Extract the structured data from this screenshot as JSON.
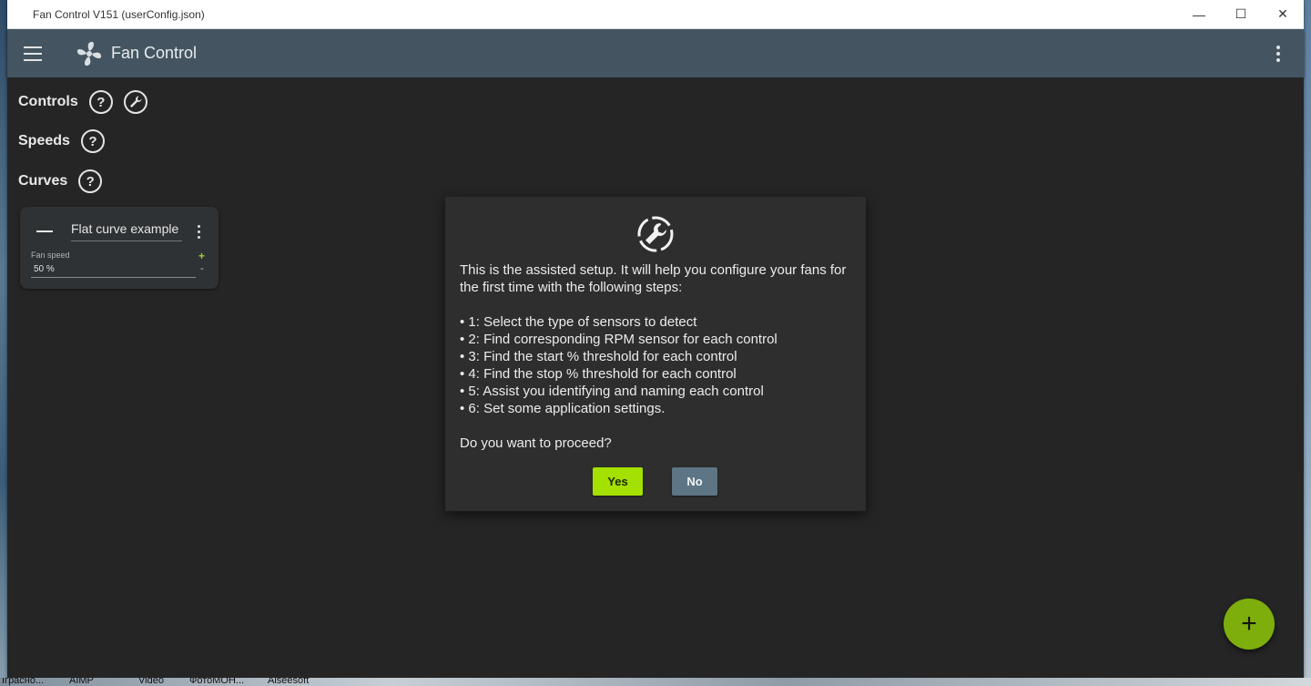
{
  "window": {
    "title": "Fan Control V151 (userConfig.json)",
    "minimize": "—",
    "maximize": "☐",
    "close": "✕"
  },
  "appbar": {
    "title": "Fan Control",
    "menu_icon": "hamburger-icon",
    "logo_icon": "fan-icon",
    "more_icon": "more-vert-icon"
  },
  "sections": {
    "controls": "Controls",
    "speeds": "Speeds",
    "curves": "Curves",
    "help_glyph": "?"
  },
  "curve_card": {
    "name": "Flat curve example",
    "fan_speed_label": "Fan speed",
    "value": "50 %",
    "plus": "+",
    "minus": "-"
  },
  "dialog": {
    "icon": "wrench-icon",
    "intro": "This is the assisted setup. It will help you configure your fans for the first time with the following steps:",
    "steps": [
      "• 1: Select the type of sensors to detect",
      "• 2: Find corresponding RPM sensor for each control",
      "• 3: Find the start % threshold for each control",
      "• 4: Find the stop % threshold for each control",
      "• 5: Assist you identifying and naming each control",
      "• 6: Set some application settings."
    ],
    "question": "Do you want to proceed?",
    "yes_label": "Yes",
    "no_label": "No"
  },
  "fab": {
    "label": "+"
  },
  "taskbar": {
    "items": [
      "Іграсно...",
      "AIMP",
      "Video",
      "ФотоМОН...",
      "Aiseesoft"
    ]
  },
  "colors": {
    "accent": "#a4e000",
    "fab": "#7dae0c",
    "appbar": "#445561",
    "background": "#252525",
    "dialog": "#2e2e2e",
    "no_button": "#5d7585"
  }
}
